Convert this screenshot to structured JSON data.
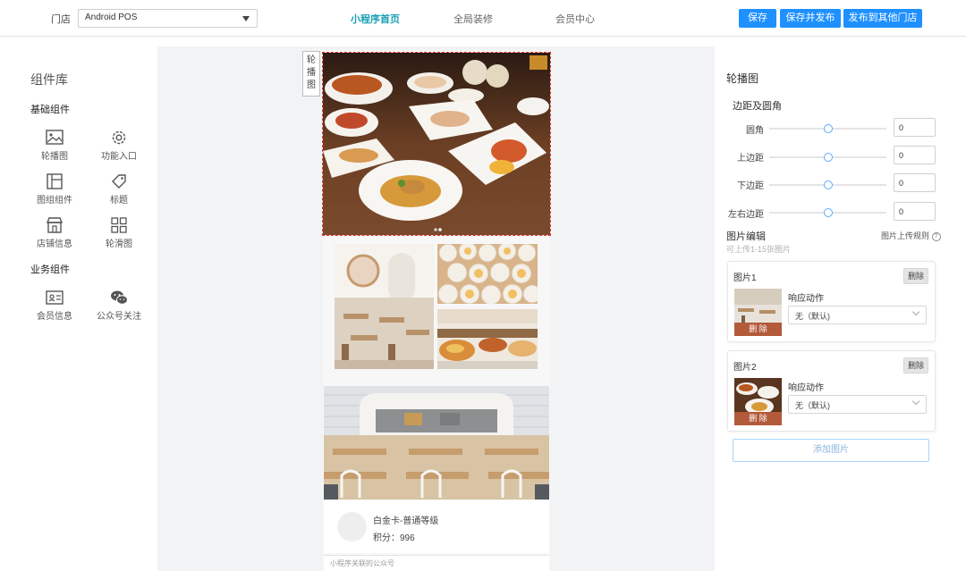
{
  "header": {
    "store_label": "门店",
    "store_value": "Android POS",
    "tabs": [
      {
        "label": "小程序首页",
        "active": true
      },
      {
        "label": "全局装修",
        "active": false
      },
      {
        "label": "会员中心",
        "active": false
      }
    ],
    "buttons": {
      "save": "保存",
      "save_publish": "保存并发布",
      "publish_other": "发布到其他门店"
    }
  },
  "library": {
    "title": "组件库",
    "basic_title": "基础组件",
    "basic_items": [
      {
        "label": "轮播图",
        "icon": "image-icon"
      },
      {
        "label": "功能入口",
        "icon": "gear-icon"
      },
      {
        "label": "图组组件",
        "icon": "layout-icon"
      },
      {
        "label": "标题",
        "icon": "tag-icon"
      },
      {
        "label": "店铺信息",
        "icon": "store-icon"
      },
      {
        "label": "轮滑图",
        "icon": "grid-icon"
      }
    ],
    "business_title": "业务组件",
    "business_items": [
      {
        "label": "会员信息",
        "icon": "id-card-icon"
      },
      {
        "label": "公众号关注",
        "icon": "wechat-icon"
      }
    ]
  },
  "preview": {
    "carousel_tag": "轮播图",
    "member_card_name": "白金卡-普通等级",
    "member_points": "积分：996",
    "official_account": "小程序关联的公众号"
  },
  "settings": {
    "title": "轮播图",
    "margin_title": "边距及圆角",
    "sliders": [
      {
        "label": "圆角",
        "value": "0"
      },
      {
        "label": "上边距",
        "value": "0"
      },
      {
        "label": "下边距",
        "value": "0"
      },
      {
        "label": "左右边距",
        "value": "0"
      }
    ],
    "image_edit_title": "图片编辑",
    "image_edit_hint": "可上传1-15张图片",
    "upload_rules": "图片上传规则",
    "images": [
      {
        "title": "图片1",
        "delete_small": "删除",
        "delete_overlay": "删 除",
        "action_label": "响应动作",
        "action_value": "无（默认)"
      },
      {
        "title": "图片2",
        "delete_small": "删除",
        "delete_overlay": "删 除",
        "action_label": "响应动作",
        "action_value": "无（默认)"
      }
    ],
    "add_image": "添加图片"
  },
  "colors": {
    "accent": "#1aa1b3",
    "primary_button": "#1e90ff",
    "selection_border": "#e53935"
  }
}
